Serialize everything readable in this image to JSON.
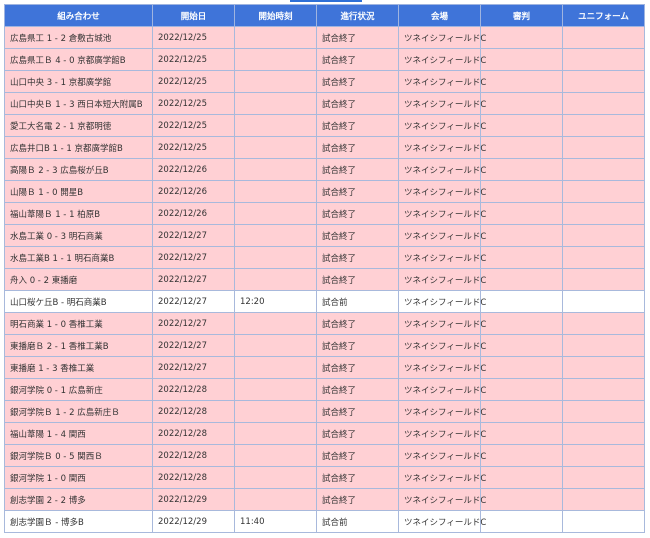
{
  "table": {
    "headers": [
      "組み合わせ",
      "開始日",
      "開始時刻",
      "進行状況",
      "会場",
      "審判",
      "ユニフォーム"
    ],
    "rows": [
      {
        "match": "広島県工 1 - 2 倉敷古城池",
        "date": "2022/12/25",
        "time": "",
        "status": "試合終了",
        "venue": "ツネイシフィールドC",
        "referee": "",
        "uniform": ""
      },
      {
        "match": "広島県工Ｂ 4 - 0 京都廣学館B",
        "date": "2022/12/25",
        "time": "",
        "status": "試合終了",
        "venue": "ツネイシフィールドC",
        "referee": "",
        "uniform": ""
      },
      {
        "match": "山口中央 3 - 1 京都廣学館",
        "date": "2022/12/25",
        "time": "",
        "status": "試合終了",
        "venue": "ツネイシフィールドC",
        "referee": "",
        "uniform": ""
      },
      {
        "match": "山口中央Ｂ 1 - 3 西日本短大附属B",
        "date": "2022/12/25",
        "time": "",
        "status": "試合終了",
        "venue": "ツネイシフィールドC",
        "referee": "",
        "uniform": ""
      },
      {
        "match": "愛工大名電 2 - 1 京都明徳",
        "date": "2022/12/25",
        "time": "",
        "status": "試合終了",
        "venue": "ツネイシフィールドC",
        "referee": "",
        "uniform": ""
      },
      {
        "match": "広島井口B 1 - 1 京都廣学館B",
        "date": "2022/12/25",
        "time": "",
        "status": "試合終了",
        "venue": "ツネイシフィールドC",
        "referee": "",
        "uniform": ""
      },
      {
        "match": "高陽Ｂ 2 - 3 広島桜が丘B",
        "date": "2022/12/26",
        "time": "",
        "status": "試合終了",
        "venue": "ツネイシフィールドC",
        "referee": "",
        "uniform": ""
      },
      {
        "match": "山陽Ｂ 1 - 0 開星B",
        "date": "2022/12/26",
        "time": "",
        "status": "試合終了",
        "venue": "ツネイシフィールドC",
        "referee": "",
        "uniform": ""
      },
      {
        "match": "福山葦陽Ｂ 1 - 1 柏原B",
        "date": "2022/12/26",
        "time": "",
        "status": "試合終了",
        "venue": "ツネイシフィールドC",
        "referee": "",
        "uniform": ""
      },
      {
        "match": "水島工業 0 - 3 明石商業",
        "date": "2022/12/27",
        "time": "",
        "status": "試合終了",
        "venue": "ツネイシフィールドC",
        "referee": "",
        "uniform": ""
      },
      {
        "match": "水島工業B 1 - 1 明石商業B",
        "date": "2022/12/27",
        "time": "",
        "status": "試合終了",
        "venue": "ツネイシフィールドC",
        "referee": "",
        "uniform": ""
      },
      {
        "match": "舟入 0 - 2 東播磨",
        "date": "2022/12/27",
        "time": "",
        "status": "試合終了",
        "venue": "ツネイシフィールドC",
        "referee": "",
        "uniform": ""
      },
      {
        "match": "山口桜ケ丘B - 明石商業B",
        "date": "2022/12/27",
        "time": "12:20",
        "status": "試合前",
        "venue": "ツネイシフィールドC",
        "referee": "",
        "uniform": ""
      },
      {
        "match": "明石商業 1 - 0 香椎工業",
        "date": "2022/12/27",
        "time": "",
        "status": "試合終了",
        "venue": "ツネイシフィールドC",
        "referee": "",
        "uniform": ""
      },
      {
        "match": "東播磨Ｂ 2 - 1 香椎工業B",
        "date": "2022/12/27",
        "time": "",
        "status": "試合終了",
        "venue": "ツネイシフィールドC",
        "referee": "",
        "uniform": ""
      },
      {
        "match": "東播磨 1 - 3 香椎工業",
        "date": "2022/12/27",
        "time": "",
        "status": "試合終了",
        "venue": "ツネイシフィールドC",
        "referee": "",
        "uniform": ""
      },
      {
        "match": "銀河学院 0 - 1 広島新庄",
        "date": "2022/12/28",
        "time": "",
        "status": "試合終了",
        "venue": "ツネイシフィールドC",
        "referee": "",
        "uniform": ""
      },
      {
        "match": "銀河学院Ｂ 1 - 2 広島新庄Ｂ",
        "date": "2022/12/28",
        "time": "",
        "status": "試合終了",
        "venue": "ツネイシフィールドC",
        "referee": "",
        "uniform": ""
      },
      {
        "match": "福山葦陽 1 - 4 関西",
        "date": "2022/12/28",
        "time": "",
        "status": "試合終了",
        "venue": "ツネイシフィールドC",
        "referee": "",
        "uniform": ""
      },
      {
        "match": "銀河学院Ｂ 0 - 5 関西Ｂ",
        "date": "2022/12/28",
        "time": "",
        "status": "試合終了",
        "venue": "ツネイシフィールドC",
        "referee": "",
        "uniform": ""
      },
      {
        "match": "銀河学院 1 - 0 関西",
        "date": "2022/12/28",
        "time": "",
        "status": "試合終了",
        "venue": "ツネイシフィールドC",
        "referee": "",
        "uniform": ""
      },
      {
        "match": "創志学園 2 - 2 博多",
        "date": "2022/12/29",
        "time": "",
        "status": "試合終了",
        "venue": "ツネイシフィールドC",
        "referee": "",
        "uniform": ""
      },
      {
        "match": "創志学園Ｂ - 博多B",
        "date": "2022/12/29",
        "time": "11:40",
        "status": "試合前",
        "venue": "ツネイシフィールドC",
        "referee": "",
        "uniform": ""
      }
    ]
  },
  "colors": {
    "header_bg": "#3f74d9",
    "finished_row_bg": "#ffd0d4",
    "pending_row_bg": "#ffffff"
  }
}
